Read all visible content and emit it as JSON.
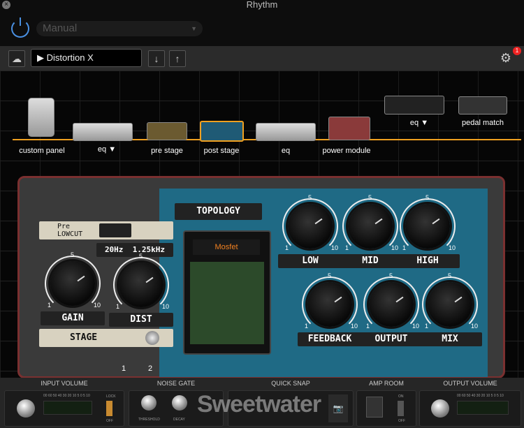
{
  "window": {
    "title": "Rhythm"
  },
  "preset_selector": {
    "value": "Manual"
  },
  "toolbar": {
    "preset_name": "Distortion X",
    "notification_count": "1"
  },
  "chain": {
    "items": [
      {
        "label": "custom panel"
      },
      {
        "label": "eq ▼"
      },
      {
        "label": "pre stage"
      },
      {
        "label": "post stage",
        "selected": true
      },
      {
        "label": "eq"
      },
      {
        "label": "power module"
      },
      {
        "label": "eq ▼"
      },
      {
        "label": "pedal match"
      }
    ]
  },
  "pedal": {
    "topology_label": "TOPOLOGY",
    "topology_value": "Mosfet",
    "lowcut": {
      "label_top": "Pre",
      "label": "LOWCUT",
      "freq1": "20Hz",
      "freq2": "1.25kHz"
    },
    "stage": {
      "label": "STAGE",
      "opt1": "1",
      "opt2": "2"
    },
    "knobs": [
      {
        "label": "GAIN",
        "min": "1",
        "mid": "5",
        "max": "10"
      },
      {
        "label": "DIST",
        "min": "1",
        "mid": "5",
        "max": "10"
      },
      {
        "label": "LOW",
        "min": "1",
        "mid": "5",
        "max": "10"
      },
      {
        "label": "MID",
        "min": "1",
        "mid": "5",
        "max": "10"
      },
      {
        "label": "HIGH",
        "min": "1",
        "mid": "5",
        "max": "10"
      },
      {
        "label": "FEEDBACK",
        "min": "1",
        "mid": "5",
        "max": "10"
      },
      {
        "label": "OUTPUT",
        "min": "1",
        "mid": "5",
        "max": "10"
      },
      {
        "label": "MIX",
        "min": "1",
        "mid": "5",
        "max": "10"
      }
    ]
  },
  "bottom": {
    "input_volume": "INPUT VOLUME",
    "noise_gate": "NOISE GATE",
    "quick_snap": "QUICK SNAP",
    "amp_room": "AMP ROOM",
    "output_volume": "OUTPUT VOLUME",
    "meter_scale": "00 60 50 40 30 20 10 5 0 5 10",
    "lock": "LOCK",
    "off": "OFF",
    "on": "ON",
    "threshold": "THRESHOLD",
    "decay": "DECAY",
    "watermark": "Sweetwater"
  }
}
